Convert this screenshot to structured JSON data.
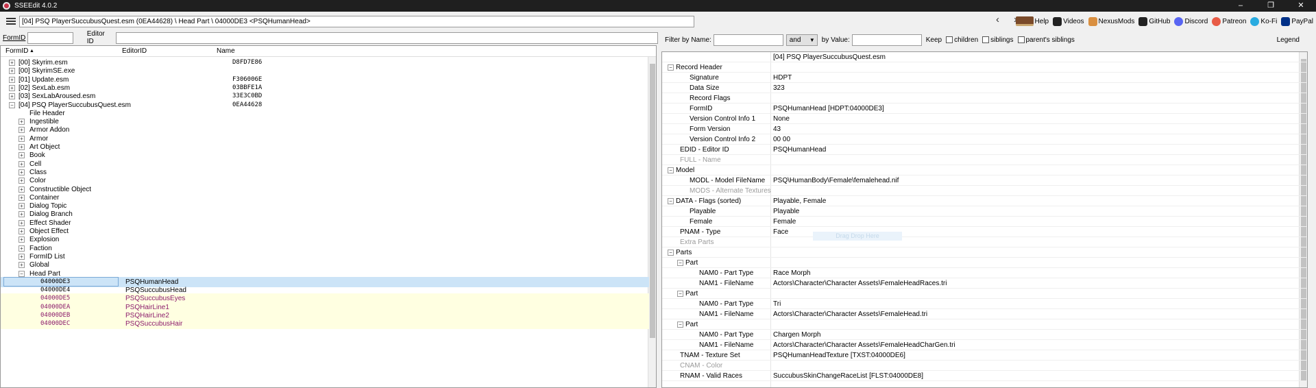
{
  "app": {
    "title": "SSEEdit 4.0.2"
  },
  "window_controls": {
    "minimize": "–",
    "maximize": "❐",
    "close": "✕"
  },
  "toolbar": {
    "path": "[04] PSQ PlayerSuccubusQuest.esm (0EA44628) \\ Head Part \\ 04000DE3 <PSQHumanHead>",
    "back": "‹",
    "forward": "›",
    "links": [
      {
        "label": "Help",
        "icon": "book-icon",
        "color": "#7a4a2a"
      },
      {
        "label": "Videos",
        "icon": "video-icon",
        "color": "#222222"
      },
      {
        "label": "NexusMods",
        "icon": "nexus-icon",
        "color": "#d98f40"
      },
      {
        "label": "GitHub",
        "icon": "github-icon",
        "color": "#222222"
      },
      {
        "label": "Discord",
        "icon": "discord-icon",
        "color": "#5865f2"
      },
      {
        "label": "Patreon",
        "icon": "patreon-icon",
        "color": "#e85b46"
      },
      {
        "label": "Ko-Fi",
        "icon": "kofi-icon",
        "color": "#29abe0"
      },
      {
        "label": "PayPal",
        "icon": "paypal-icon",
        "color": "#003087"
      }
    ]
  },
  "search": {
    "formid_label": "FormID",
    "editorid_label": "Editor ID",
    "formid_value": "",
    "editorid_value": ""
  },
  "left_tree": {
    "columns": {
      "formid": "FormID",
      "sort_arrow": "▲",
      "editorid": "EditorID",
      "name": "Name"
    },
    "rows": [
      {
        "label": "[00] Skyrim.esm",
        "fid": "D8FD7E86",
        "exp": "+"
      },
      {
        "label": "[00] SkyrimSE.exe",
        "fid": "",
        "exp": "+"
      },
      {
        "label": "[01] Update.esm",
        "fid": "F306006E",
        "exp": "+"
      },
      {
        "label": "[02] SexLab.esm",
        "fid": "03BBFE1A",
        "exp": "+"
      },
      {
        "label": "[03] SexLabAroused.esm",
        "fid": "33E3C0BD",
        "exp": "+"
      },
      {
        "label": "[04] PSQ PlayerSuccubusQuest.esm",
        "fid": "0EA44628",
        "exp": "−"
      },
      {
        "label": "File Header",
        "fid": "",
        "exp": ""
      },
      {
        "label": "Ingestible",
        "fid": "",
        "exp": "+"
      },
      {
        "label": "Armor Addon",
        "fid": "",
        "exp": "+"
      },
      {
        "label": "Armor",
        "fid": "",
        "exp": "+"
      },
      {
        "label": "Art Object",
        "fid": "",
        "exp": "+"
      },
      {
        "label": "Book",
        "fid": "",
        "exp": "+"
      },
      {
        "label": "Cell",
        "fid": "",
        "exp": "+"
      },
      {
        "label": "Class",
        "fid": "",
        "exp": "+"
      },
      {
        "label": "Color",
        "fid": "",
        "exp": "+"
      },
      {
        "label": "Constructible Object",
        "fid": "",
        "exp": "+"
      },
      {
        "label": "Container",
        "fid": "",
        "exp": "+"
      },
      {
        "label": "Dialog Topic",
        "fid": "",
        "exp": "+"
      },
      {
        "label": "Dialog Branch",
        "fid": "",
        "exp": "+"
      },
      {
        "label": "Effect Shader",
        "fid": "",
        "exp": "+"
      },
      {
        "label": "Object Effect",
        "fid": "",
        "exp": "+"
      },
      {
        "label": "Explosion",
        "fid": "",
        "exp": "+"
      },
      {
        "label": "Faction",
        "fid": "",
        "exp": "+"
      },
      {
        "label": "FormID List",
        "fid": "",
        "exp": "+"
      },
      {
        "label": "Global",
        "fid": "",
        "exp": "+"
      },
      {
        "label": "Head Part",
        "fid": "",
        "exp": "−"
      }
    ],
    "records": [
      {
        "formid": "04000DE3",
        "editorid": "PSQHumanHead",
        "state": "selected"
      },
      {
        "formid": "04000DE4",
        "editorid": "PSQSuccubusHead",
        "state": "normal"
      },
      {
        "formid": "04000DE5",
        "editorid": "PSQSuccubusEyes",
        "state": "highlight"
      },
      {
        "formid": "04000DEA",
        "editorid": "PSQHairLine1",
        "state": "highlight"
      },
      {
        "formid": "04000DEB",
        "editorid": "PSQHairLine2",
        "state": "highlight"
      },
      {
        "formid": "04000DEC",
        "editorid": "PSQSuccubusHair",
        "state": "highlight"
      }
    ]
  },
  "filter": {
    "by_name_label": "Filter by Name:",
    "name_value": "",
    "operator": "and",
    "by_value_label": "by Value:",
    "value_value": "",
    "keep_label": "Keep",
    "children_label": "children",
    "siblings_label": "siblings",
    "parents_siblings_label": "parent's siblings",
    "legend_label": "Legend"
  },
  "record_view": {
    "drag_hint": "Drag Drop Here",
    "rows": [
      {
        "key": "",
        "value": "[04] PSQ PlayerSuccubusQuest.esm",
        "indent": 0,
        "exp": "",
        "grey": false
      },
      {
        "key": "Record Header",
        "value": "",
        "indent": 1,
        "exp": "−",
        "grey": false
      },
      {
        "key": "Signature",
        "value": "HDPT",
        "indent": 2,
        "exp": "",
        "grey": false
      },
      {
        "key": "Data Size",
        "value": "323",
        "indent": 2,
        "exp": "",
        "grey": false
      },
      {
        "key": "Record Flags",
        "value": "",
        "indent": 2,
        "exp": "",
        "grey": false
      },
      {
        "key": "FormID",
        "value": "PSQHumanHead [HDPT:04000DE3]",
        "indent": 2,
        "exp": "",
        "grey": false
      },
      {
        "key": "Version Control Info 1",
        "value": "None",
        "indent": 2,
        "exp": "",
        "grey": false
      },
      {
        "key": "Form Version",
        "value": "43",
        "indent": 2,
        "exp": "",
        "grey": false
      },
      {
        "key": "Version Control Info 2",
        "value": "00 00",
        "indent": 2,
        "exp": "",
        "grey": false
      },
      {
        "key": "EDID - Editor ID",
        "value": "PSQHumanHead",
        "indent": 1,
        "exp": "",
        "grey": false
      },
      {
        "key": "FULL - Name",
        "value": "",
        "indent": 1,
        "exp": "",
        "grey": true
      },
      {
        "key": "Model",
        "value": "",
        "indent": 1,
        "exp": "−",
        "grey": false
      },
      {
        "key": "MODL - Model FileName",
        "value": "PSQ\\HumanBody\\Female\\femalehead.nif",
        "indent": 2,
        "exp": "",
        "grey": false
      },
      {
        "key": "MODS - Alternate Textures",
        "value": "",
        "indent": 2,
        "exp": "",
        "grey": true
      },
      {
        "key": "DATA - Flags (sorted)",
        "value": "Playable, Female",
        "indent": 1,
        "exp": "−",
        "grey": false
      },
      {
        "key": "Playable",
        "value": "Playable",
        "indent": 2,
        "exp": "",
        "grey": false
      },
      {
        "key": "Female",
        "value": "Female",
        "indent": 2,
        "exp": "",
        "grey": false
      },
      {
        "key": "PNAM - Type",
        "value": "Face",
        "indent": 1,
        "exp": "",
        "grey": false
      },
      {
        "key": "Extra Parts",
        "value": "",
        "indent": 1,
        "exp": "",
        "grey": true
      },
      {
        "key": "Parts",
        "value": "",
        "indent": 1,
        "exp": "−",
        "grey": false
      },
      {
        "key": "Part",
        "value": "",
        "indent": 2,
        "exp": "−",
        "grey": false
      },
      {
        "key": "NAM0 - Part Type",
        "value": "Race Morph",
        "indent": 3,
        "exp": "",
        "grey": false
      },
      {
        "key": "NAM1 - FileName",
        "value": "Actors\\Character\\Character Assets\\FemaleHeadRaces.tri",
        "indent": 3,
        "exp": "",
        "grey": false
      },
      {
        "key": "Part",
        "value": "",
        "indent": 2,
        "exp": "−",
        "grey": false
      },
      {
        "key": "NAM0 - Part Type",
        "value": "Tri",
        "indent": 3,
        "exp": "",
        "grey": false
      },
      {
        "key": "NAM1 - FileName",
        "value": "Actors\\Character\\Character Assets\\FemaleHead.tri",
        "indent": 3,
        "exp": "",
        "grey": false
      },
      {
        "key": "Part",
        "value": "",
        "indent": 2,
        "exp": "−",
        "grey": false
      },
      {
        "key": "NAM0 - Part Type",
        "value": "Chargen Morph",
        "indent": 3,
        "exp": "",
        "grey": false
      },
      {
        "key": "NAM1 - FileName",
        "value": "Actors\\Character\\Character Assets\\FemaleHeadCharGen.tri",
        "indent": 3,
        "exp": "",
        "grey": false
      },
      {
        "key": "TNAM - Texture Set",
        "value": "PSQHumanHeadTexture [TXST:04000DE6]",
        "indent": 1,
        "exp": "",
        "grey": false
      },
      {
        "key": "CNAM - Color",
        "value": "",
        "indent": 1,
        "exp": "",
        "grey": true
      },
      {
        "key": "RNAM - Valid Races",
        "value": "SuccubusSkinChangeRaceList [FLST:04000DE8]",
        "indent": 1,
        "exp": "",
        "grey": false
      }
    ]
  }
}
